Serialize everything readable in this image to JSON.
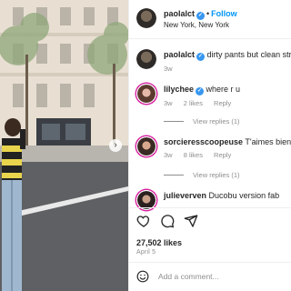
{
  "post": {
    "username": "paolalct",
    "follow_label": "Follow",
    "location": "New York, New York",
    "caption_text": "dirty pants but clean streets",
    "caption_time": "3w",
    "likes_text": "27,502 likes",
    "date": "April 5",
    "add_comment_placeholder": "Add a comment..."
  },
  "comments": [
    {
      "username": "lilychee",
      "text": "where r u",
      "time": "3w",
      "likes": "2 likes",
      "reply_label": "Reply",
      "view_replies": "View replies (1)",
      "verified": true
    },
    {
      "username": "sorcieresscoopeuse",
      "text": "T'aimes bien ?",
      "time": "3w",
      "likes": "8 likes",
      "reply_label": "Reply",
      "view_replies": "View replies (1)",
      "verified": false
    },
    {
      "username": "julieverven",
      "text": "Ducobu version fab",
      "verified": false
    }
  ],
  "icons": {
    "verified": "verified-badge-icon",
    "like": "heart-icon",
    "comment": "comment-icon",
    "share": "share-icon",
    "emoji": "emoji-icon",
    "carousel_next": "chevron-right-icon"
  },
  "colors": {
    "accent": "#0095f6",
    "verified": "#3897f0",
    "muted": "#8e8e8e",
    "text": "#262626"
  }
}
